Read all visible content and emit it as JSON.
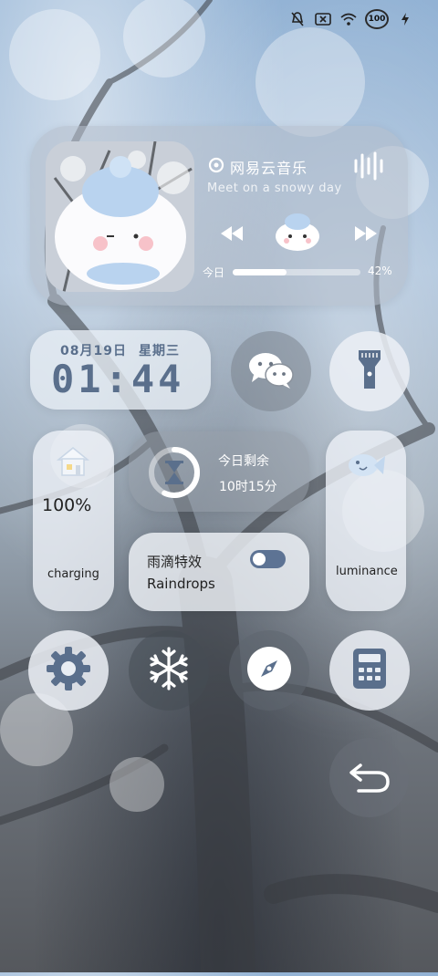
{
  "status_bar": {
    "icons": [
      "mute-icon",
      "no-sim-icon",
      "wifi-icon",
      "battery-icon",
      "charging-bolt-icon"
    ],
    "battery_level": "100"
  },
  "music": {
    "app_name": "网易云音乐",
    "song": "Meet on a snowy day",
    "progress_label": "今日",
    "progress_percent": "42%",
    "progress_value": 0.42,
    "icons": [
      "netease-logo-icon",
      "sound-wave-icon",
      "rewind-icon",
      "album-mascot-icon",
      "fast-forward-icon"
    ]
  },
  "clock": {
    "date": "08月19日",
    "weekday": "星期三",
    "time": "01:44"
  },
  "quick": {
    "wechat_icon": "wechat-icon",
    "flashlight_icon": "flashlight-icon"
  },
  "battery": {
    "percent": "100%",
    "label": "charging",
    "icon": "house-icon"
  },
  "remaining": {
    "title": "今日剩余",
    "value": "10时15分",
    "icon": "hourglass-icon",
    "ring_progress": 0.57
  },
  "raindrops": {
    "title_cn": "雨滴特效",
    "title_en": "Raindrops",
    "toggle_on": false
  },
  "luminance": {
    "label": "luminance",
    "icon": "fish-icon"
  },
  "bottom_row": {
    "icons": [
      "settings-gear-icon",
      "snowflake-icon",
      "compass-icon",
      "calculator-icon"
    ]
  },
  "back": {
    "icon": "back-arrow-icon"
  },
  "colors": {
    "accent": "#5a6f8c",
    "glass": "#e9eef4",
    "toggle": "#5d7394"
  }
}
